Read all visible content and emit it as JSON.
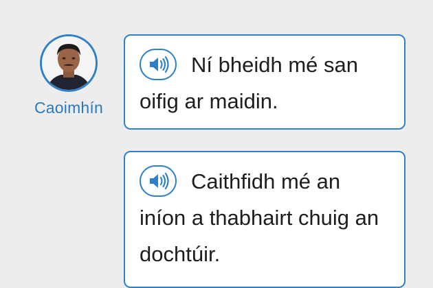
{
  "speaker": {
    "name": "Caoimhín"
  },
  "messages": [
    {
      "text": "Ní bheidh mé san oifig ar maidin.",
      "audio_icon": "speaker-volume-icon"
    },
    {
      "text": "Caithfidh mé an iníon a thabhairt chuig an dochtúir.",
      "audio_icon": "speaker-volume-icon"
    }
  ],
  "colors": {
    "accent": "#2f80c8",
    "background": "#ededed",
    "bubble_background": "#ffffff",
    "text": "#1d1d1d"
  }
}
